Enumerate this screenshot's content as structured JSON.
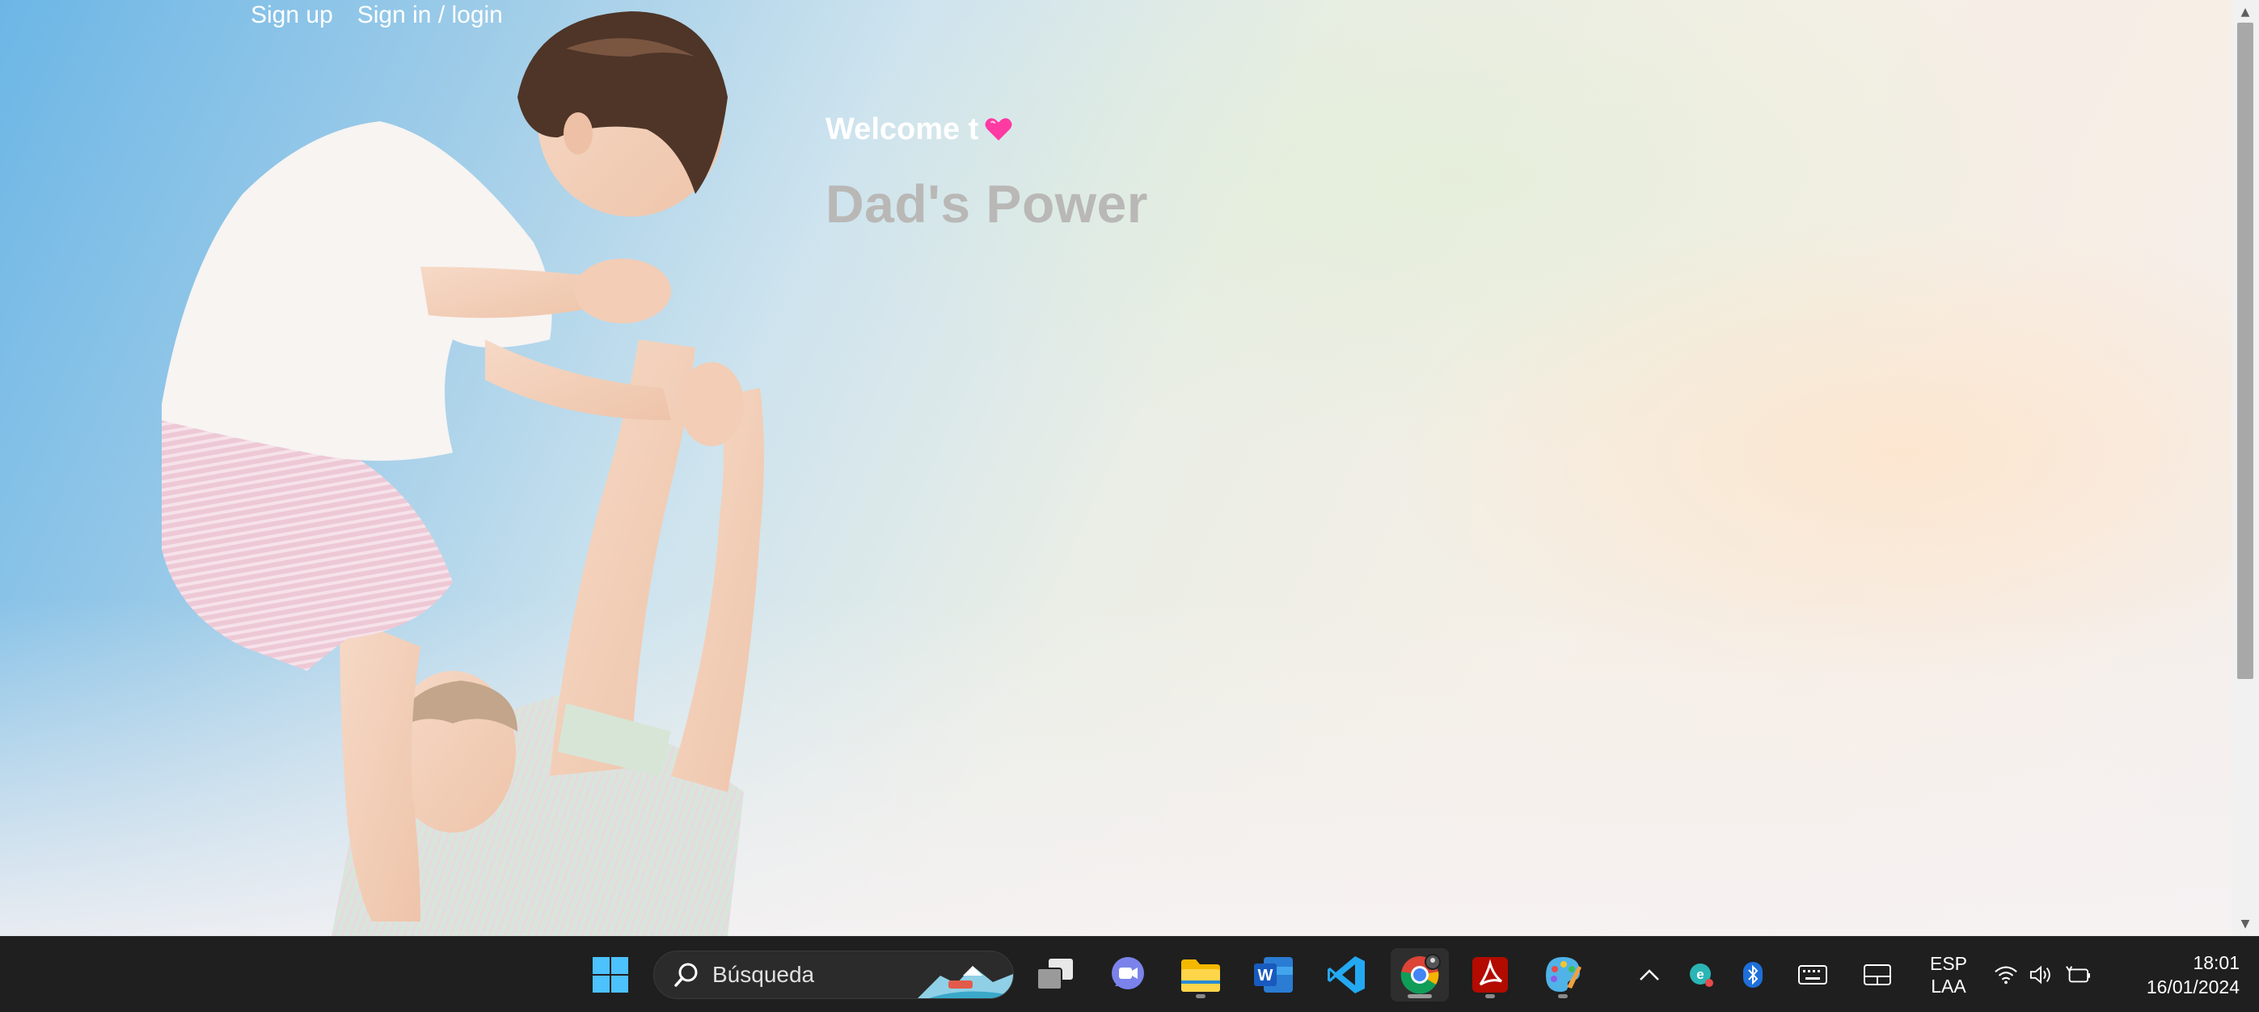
{
  "nav": {
    "signup_label": "Sign up",
    "signin_label": "Sign in / login"
  },
  "hero": {
    "welcome_text": "Welcome t",
    "title": "Dad's Power"
  },
  "taskbar": {
    "search_placeholder": "Búsqueda",
    "apps": [
      {
        "name": "start-icon"
      },
      {
        "name": "task-view-icon"
      },
      {
        "name": "teams-chat-icon"
      },
      {
        "name": "file-explorer-icon"
      },
      {
        "name": "word-icon"
      },
      {
        "name": "vscode-icon"
      },
      {
        "name": "chrome-icon"
      },
      {
        "name": "acrobat-icon"
      },
      {
        "name": "paint-icon"
      }
    ],
    "tray": {
      "language_line1": "ESP",
      "language_line2": "LAA",
      "time": "18:01",
      "date": "16/01/2024"
    }
  },
  "colors": {
    "title_gray": "#b9b8b6",
    "heart_pink": "#ff3aa3",
    "taskbar_bg": "#1f1f1f"
  }
}
